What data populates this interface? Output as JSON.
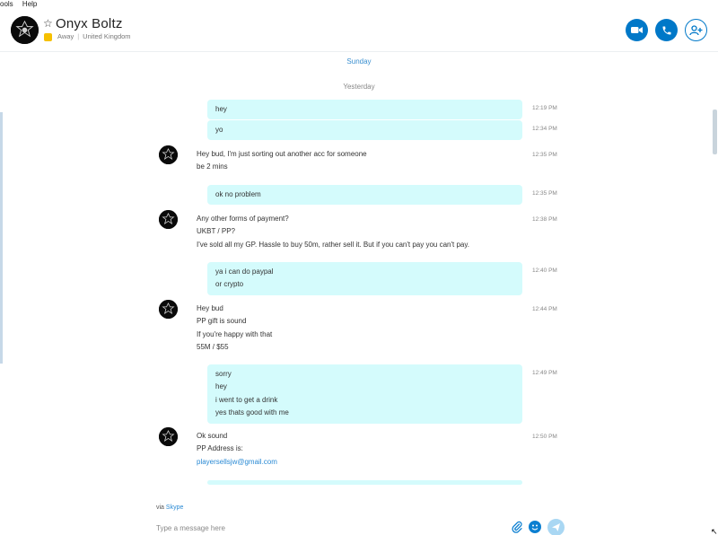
{
  "menu": [
    "ools",
    "Help"
  ],
  "contact": {
    "name": "Onyx Boltz",
    "status": "Away",
    "location": "United Kingdom"
  },
  "day_separators": {
    "sunday": "Sunday",
    "yesterday": "Yesterday"
  },
  "messages": [
    {
      "from": "me",
      "lines": [
        "hey"
      ],
      "time": "12:19 PM"
    },
    {
      "from": "me",
      "lines": [
        "yo"
      ],
      "time": "12:34 PM"
    },
    {
      "from": "them",
      "lines": [
        "Hey bud, I'm just sorting out another acc for someone",
        "be 2 mins"
      ],
      "time": "12:35 PM"
    },
    {
      "from": "me",
      "lines": [
        "ok no problem"
      ],
      "time": "12:35 PM"
    },
    {
      "from": "them",
      "lines": [
        "Any other forms of payment?",
        "UKBT / PP?",
        "I've sold all my GP. Hassle to buy 50m, rather sell it. But if you can't pay you can't pay."
      ],
      "time": "12:38 PM"
    },
    {
      "from": "me",
      "lines": [
        "ya i can do paypal",
        "or crypto"
      ],
      "time": "12:40 PM"
    },
    {
      "from": "them",
      "lines": [
        "Hey bud",
        "PP gift is sound",
        "If you're happy with that",
        "55M / $55"
      ],
      "time": "12:44 PM"
    },
    {
      "from": "me",
      "lines": [
        "sorry",
        "hey",
        "i went to get a drink",
        "yes thats good with me"
      ],
      "time": "12:49 PM"
    },
    {
      "from": "them",
      "lines": [
        "Ok sound",
        "PP Address is:",
        "playersellsjw@gmail.com"
      ],
      "time": "12:50 PM"
    }
  ],
  "footer": {
    "via": "via",
    "via_service": "Skype",
    "composer_placeholder": "Type a message here"
  },
  "icons": {
    "video": "video-call-icon",
    "call": "phone-icon",
    "add": "add-person-icon",
    "attach": "paperclip-icon",
    "emoji": "emoji-icon",
    "send": "send-icon",
    "star": "star-icon"
  },
  "colors": {
    "accent": "#0078c8",
    "bubble": "#d4fbfc",
    "away": "#f6c000",
    "link": "#2a8ad4"
  }
}
